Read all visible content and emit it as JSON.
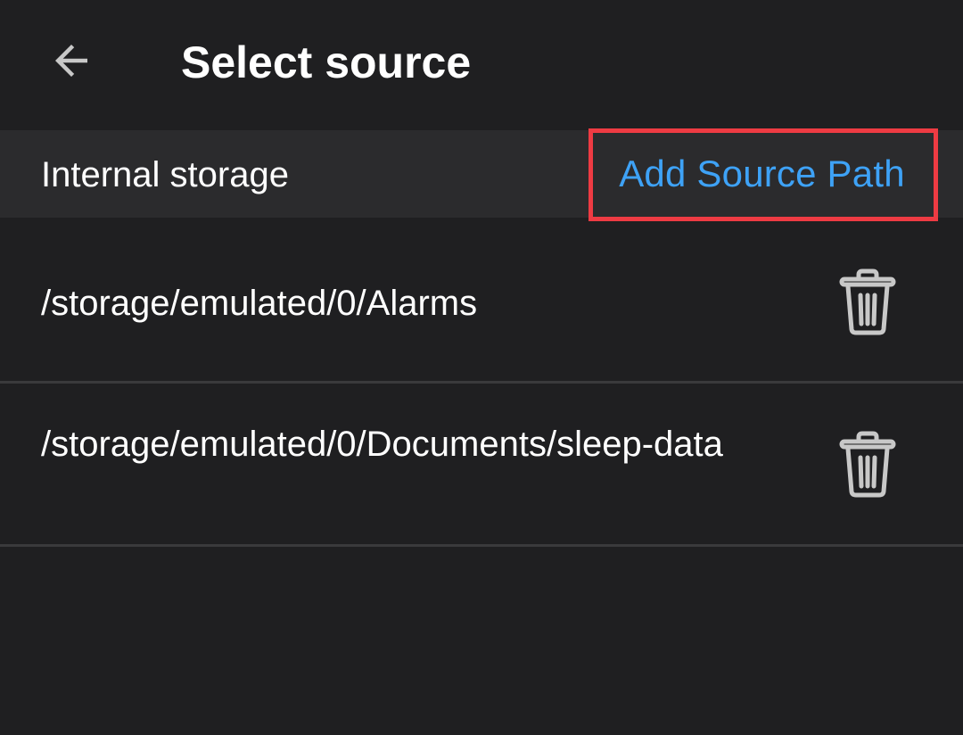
{
  "app_bar": {
    "back_icon": "arrow-left-icon",
    "title": "Select source"
  },
  "section": {
    "label": "Internal storage",
    "action_label": "Add Source Path",
    "action_color": "#3ea2f6",
    "highlight_color": "#ee3b43"
  },
  "paths": [
    {
      "path": "/storage/emulated/0/Alarms",
      "delete_icon": "trash-icon"
    },
    {
      "path": "/storage/emulated/0/Documents/sleep-data",
      "delete_icon": "trash-icon"
    }
  ],
  "colors": {
    "background": "#1f1f21",
    "section_background": "#2b2b2d",
    "divider": "#3a3a3c",
    "icon": "#c8c8c8"
  }
}
